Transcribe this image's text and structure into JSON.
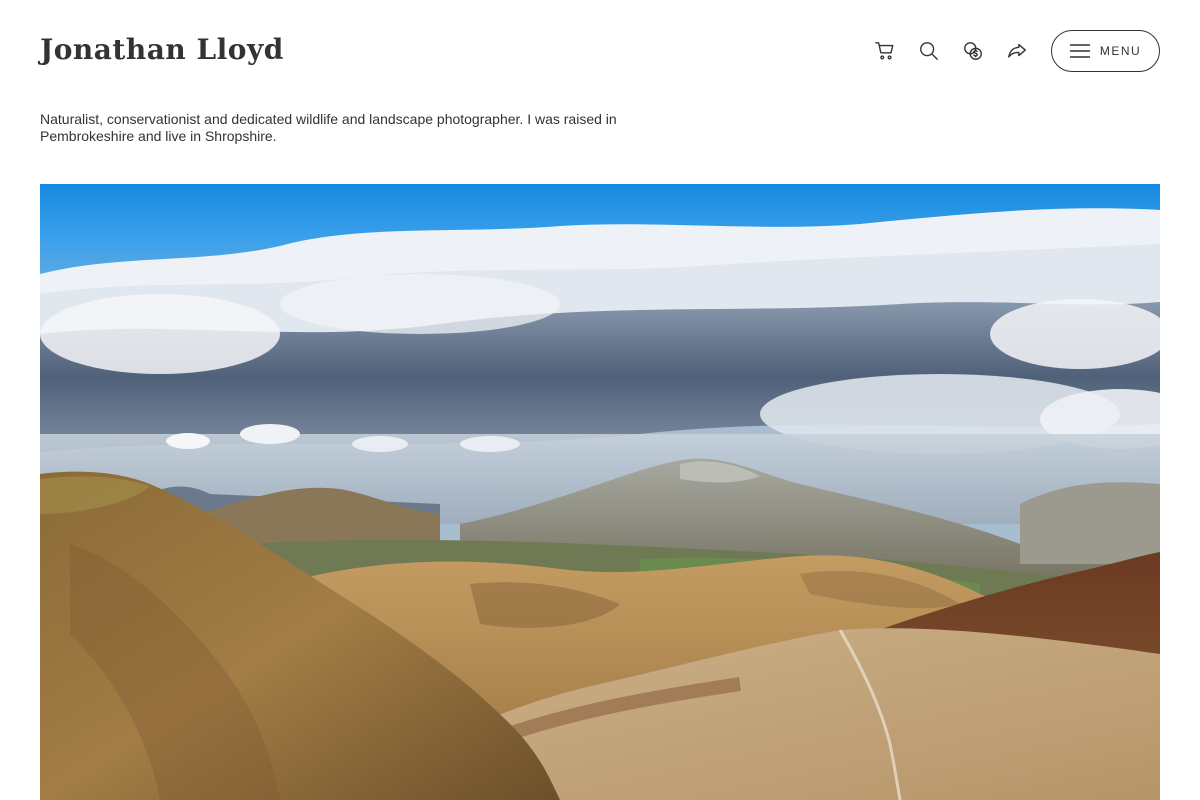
{
  "site": {
    "title": "Jonathan Lloyd",
    "bio": "Naturalist, conservationist and dedicated wildlife and landscape photographer. I was raised in Pembrokeshire and live in Shropshire."
  },
  "nav": {
    "icons": [
      "cart-icon",
      "search-icon",
      "currency-icon",
      "share-icon"
    ],
    "menu_label": "MENU"
  },
  "hero": {
    "subject": "mountain landscape under cloudy blue sky"
  },
  "colors": {
    "text": "#333333",
    "background": "#ffffff",
    "sky": "#1a8fe0"
  }
}
